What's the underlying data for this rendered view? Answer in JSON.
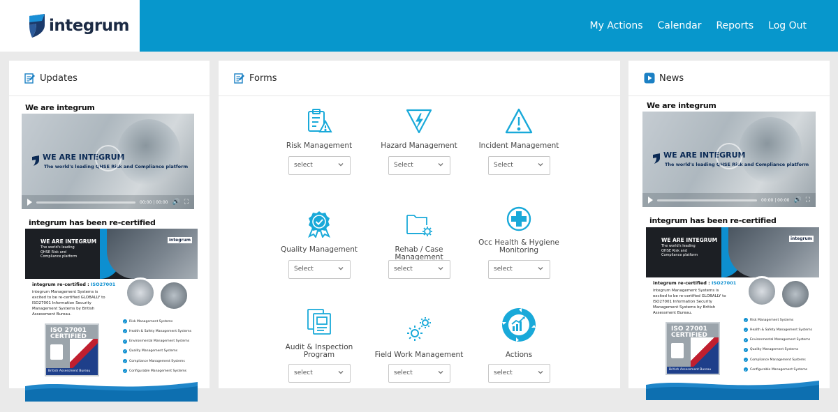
{
  "brand": {
    "name": "integrum"
  },
  "nav": [
    {
      "label": "My Actions"
    },
    {
      "label": "Calendar"
    },
    {
      "label": "Reports"
    },
    {
      "label": "Log Out"
    }
  ],
  "colors": {
    "topbar": "#0797cc",
    "accent": "#19a9d9",
    "brand_dark": "#1b2a44"
  },
  "updates": {
    "title": "Updates",
    "icon": "edit-note-icon",
    "post1_title": "We are integrum",
    "post2_title": "integrum has been re-certified"
  },
  "news": {
    "title": "News",
    "icon": "play-square-icon",
    "post1_title": "We are integrum",
    "post2_title": "integrum has been re-certified"
  },
  "video": {
    "brand_text": "WE ARE INTEGRUM",
    "tagline": "The world's leading QHSE Risk and Compliance platform",
    "time": "00:00 | 00:00"
  },
  "poster": {
    "brand_text": "WE ARE INTEGRUM",
    "tagline": "The world's leading QHSE Risk and Compliance platform",
    "logo_text": "integrum",
    "heading": "integrum re-certified :",
    "heading_highlight": "ISO27001",
    "body": "integrum Management Systems is excited to be re-certified GLOBALLY to ISO27001 Information Security Management Systems by British Assessment Bureau.",
    "cert_line1": "ISO 27001",
    "cert_line2": "CERTIFIED",
    "cert_footer": "British Assessment Bureau",
    "list": [
      "Risk Management Systems",
      "Health & Safety Management Systems",
      "Environmental Management Systems",
      "Quality Management Systems",
      "Compliance Management Systems",
      "Configurable Management Systems"
    ]
  },
  "forms": {
    "title": "Forms",
    "icon": "edit-note-icon",
    "items": [
      {
        "label": "Risk Management",
        "select": "select",
        "icon": "clipboard-warning-icon"
      },
      {
        "label": "Hazard Management",
        "select": "Select",
        "icon": "electric-hazard-icon"
      },
      {
        "label": "Incident Management",
        "select": "Select",
        "icon": "warning-triangle-icon"
      },
      {
        "label": "Quality Management",
        "select": "Select",
        "icon": "quality-badge-icon"
      },
      {
        "label": "Rehab / Case Management",
        "select": "select",
        "icon": "folder-gear-icon"
      },
      {
        "label": "Occ Health & Hygiene Monitoring",
        "select": "select",
        "icon": "medical-cross-icon"
      },
      {
        "label": "Audit & Inspection Program",
        "select": "select",
        "icon": "audit-document-icon"
      },
      {
        "label": "Field Work Management",
        "select": "select",
        "icon": "gears-icon"
      },
      {
        "label": "Actions",
        "select": "select",
        "icon": "actions-cycle-icon"
      }
    ]
  }
}
